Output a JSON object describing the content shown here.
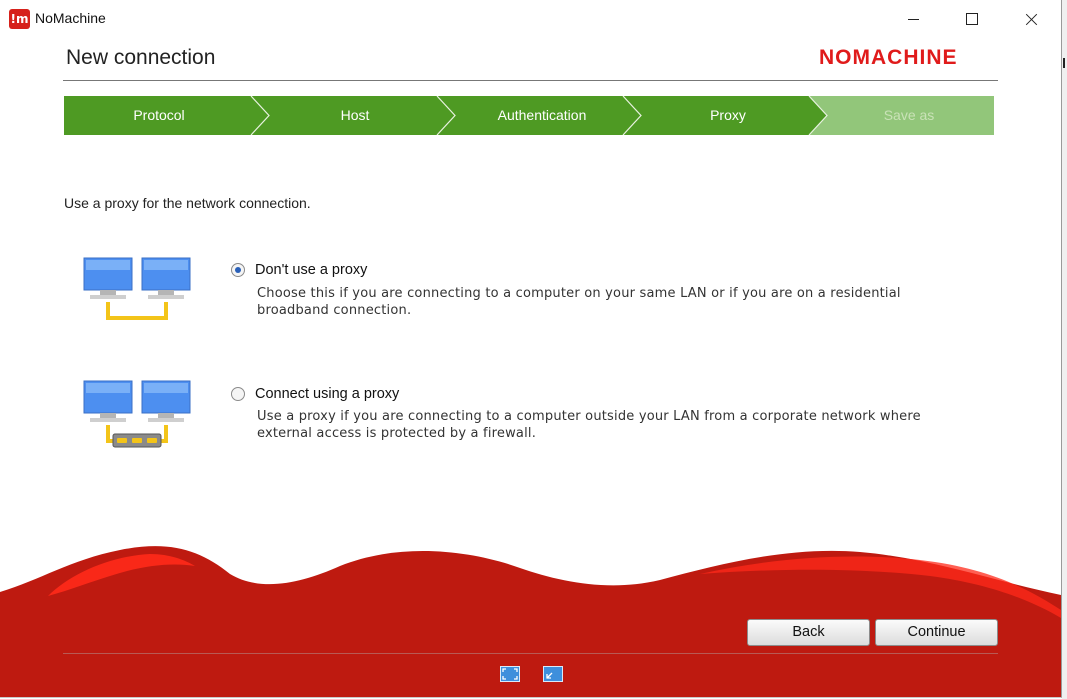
{
  "app": {
    "title": "NoMachine",
    "icon_text": "!m"
  },
  "window_controls": {
    "minimize": "minimize-icon",
    "maximize": "maximize-icon",
    "close": "close-icon"
  },
  "header": {
    "title": "New connection",
    "brand": "NOMACHINE"
  },
  "wizard": {
    "steps": [
      {
        "label": "Protocol",
        "state": "done"
      },
      {
        "label": "Host",
        "state": "done"
      },
      {
        "label": "Authentication",
        "state": "done"
      },
      {
        "label": "Proxy",
        "state": "current"
      },
      {
        "label": "Save as",
        "state": "inactive"
      }
    ],
    "colors": {
      "active": "#4e9a23",
      "inactive": "#92c67a"
    }
  },
  "intro": "Use a proxy for the network connection.",
  "options": [
    {
      "title": "Don't use a proxy",
      "description": "Choose this if you are connecting to a computer on your same LAN or if you are on a residential broadband connection.",
      "selected": true,
      "icon": "direct-lan-icon"
    },
    {
      "title": "Connect using a proxy",
      "description": "Use a proxy if you are connecting to a computer outside your LAN from a corporate network where external access is protected by a firewall.",
      "selected": false,
      "icon": "proxy-firewall-icon"
    }
  ],
  "buttons": {
    "back": "Back",
    "continue": "Continue"
  },
  "bottom_icons": [
    "fullscreen-icon",
    "window-mode-icon"
  ],
  "colors": {
    "brand_red": "#e01b1b",
    "footer_red": "#be1a10"
  }
}
